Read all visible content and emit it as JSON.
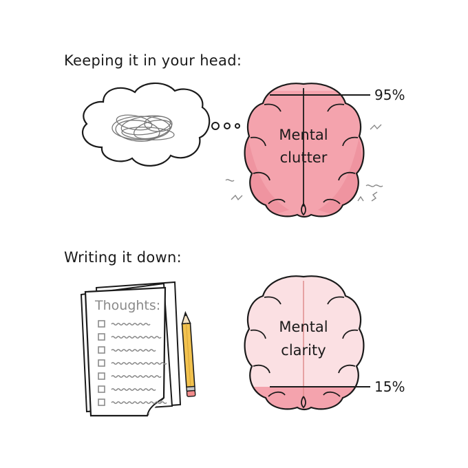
{
  "section_top": {
    "heading": "Keeping it in your head:",
    "brain_label_line1": "Mental",
    "brain_label_line2": "clutter",
    "percent": "95%",
    "fill_fraction": 0.95
  },
  "section_bottom": {
    "heading": "Writing it down:",
    "note_title": "Thoughts:",
    "brain_label_line1": "Mental",
    "brain_label_line2": "clarity",
    "percent": "15%",
    "fill_fraction": 0.15,
    "checklist_count": 7
  },
  "colors": {
    "ink": "#1a1a1a",
    "brain_full": "#f4a3ad",
    "brain_full_dark": "#ea8593",
    "brain_light": "#fbe0e3",
    "pencil": "#f2c24e",
    "scribble": "#777777"
  },
  "icons": [
    "thought-cloud-icon",
    "brain-icon",
    "paper-stack-icon",
    "pencil-icon"
  ]
}
